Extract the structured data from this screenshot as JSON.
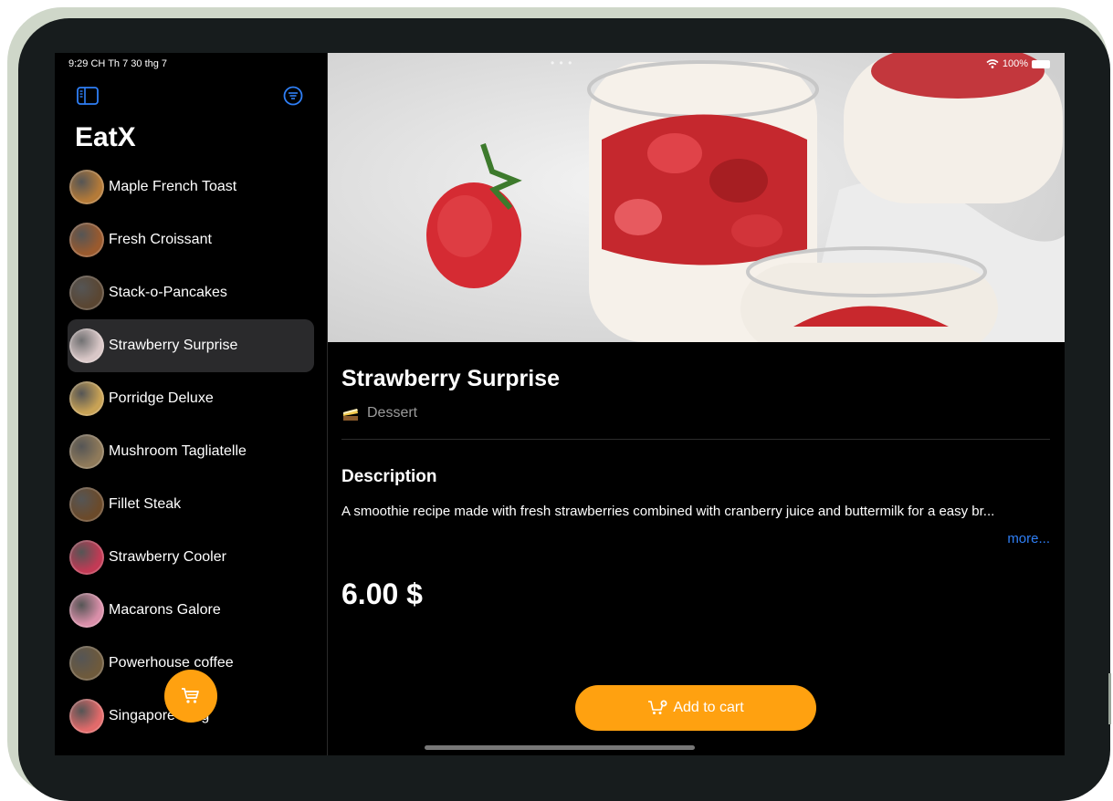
{
  "status": {
    "time": "9:29 CH   Th 7 30 thg 7",
    "dots": "• • •",
    "battery": "100%"
  },
  "app": {
    "title": "EatX"
  },
  "menu": [
    {
      "label": "Maple French Toast",
      "thumb": "#b47a38"
    },
    {
      "label": "Fresh Croissant",
      "thumb": "#9a5a2e"
    },
    {
      "label": "Stack-o-Pancakes",
      "thumb": "#5a4632"
    },
    {
      "label": "Strawberry Surprise",
      "thumb": "#d9c7c7"
    },
    {
      "label": "Porridge Deluxe",
      "thumb": "#c8a255"
    },
    {
      "label": "Mushroom Tagliatelle",
      "thumb": "#8f7a5a"
    },
    {
      "label": "Fillet Steak",
      "thumb": "#6b4a2a"
    },
    {
      "label": "Strawberry Cooler",
      "thumb": "#c23a55"
    },
    {
      "label": "Macarons Galore",
      "thumb": "#d98fa9"
    },
    {
      "label": "Powerhouse coffee",
      "thumb": "#6e5a3c"
    },
    {
      "label": "Singapore sling",
      "thumb": "#e26a6a"
    }
  ],
  "selected_index": 3,
  "detail": {
    "name": "Strawberry Surprise",
    "category": "Dessert",
    "description_heading": "Description",
    "description": "A smoothie recipe made with fresh strawberries combined with cranberry juice and buttermilk for a easy br...",
    "more_label": "more...",
    "price": "6.00 $",
    "add_to_cart_label": "Add to cart"
  },
  "colors": {
    "accent": "#ffa110",
    "link": "#2f7ff6",
    "background": "#000000"
  },
  "icons": {
    "sidebar_toggle": "sidebar-toggle-icon",
    "filter": "filter-icon",
    "cart": "cart-icon",
    "category": "cake-icon"
  }
}
